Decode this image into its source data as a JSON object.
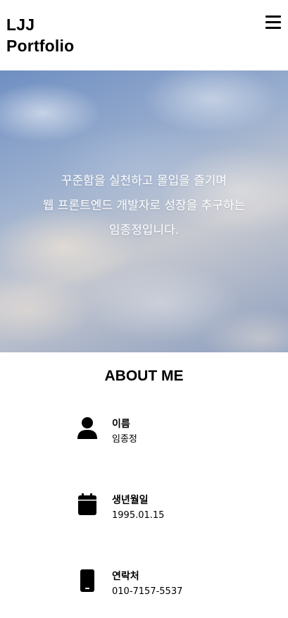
{
  "header": {
    "logo_line1": "LJJ",
    "logo_line2": "Portfolio",
    "menu_icon": "hamburger-menu-icon"
  },
  "hero": {
    "lines": [
      "꾸준함을 실천하고 몰입을 즐기며",
      "웹 프론트엔드 개발자로 성장을 추구하는",
      "임종정입니다."
    ]
  },
  "about": {
    "title": "ABOUT ME",
    "items": [
      {
        "icon": "person-icon",
        "label": "이름",
        "value": "임종정"
      },
      {
        "icon": "calendar-icon",
        "label": "생년월일",
        "value": "1995.01.15"
      },
      {
        "icon": "mobile-phone-icon",
        "label": "연락처",
        "value": "010-7157-5537"
      }
    ]
  },
  "colors": {
    "text": "#000000",
    "hero_text": "#ffffff",
    "background": "#ffffff"
  }
}
